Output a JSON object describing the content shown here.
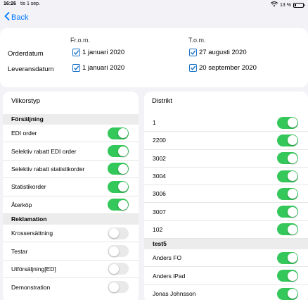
{
  "status_bar": {
    "time": "16:26",
    "date": "tis 1 sep.",
    "battery": "13 %",
    "battery_level": 0.13
  },
  "nav": {
    "back_label": "Back"
  },
  "dates": {
    "from_header": "Fr.o.m.",
    "to_header": "T.o.m.",
    "rows": [
      {
        "label": "Orderdatum",
        "from": "1 januari 2020",
        "to": "27 augusti 2020"
      },
      {
        "label": "Leveransdatum",
        "from": "1 januari 2020",
        "to": "20 september 2020"
      }
    ]
  },
  "vilkorstyp": {
    "title": "Vilkorstyp",
    "groups": [
      {
        "header": "Försäljning",
        "items": [
          {
            "label": "EDI order",
            "on": true
          },
          {
            "label": "Selektiv rabatt EDI order",
            "on": true
          },
          {
            "label": "Selektiv rabatt statistikorder",
            "on": true
          },
          {
            "label": "Statistikorder",
            "on": true
          },
          {
            "label": "Återköp",
            "on": true
          }
        ]
      },
      {
        "header": "Reklamation",
        "items": [
          {
            "label": "Krossersättning",
            "on": false
          },
          {
            "label": "Testar",
            "on": false
          },
          {
            "label": "Utförsäljning[ED]",
            "on": false
          },
          {
            "label": "Demonstration",
            "on": false
          }
        ]
      }
    ]
  },
  "distrikt": {
    "title": "Distrikt",
    "groups": [
      {
        "header": "",
        "items": [
          {
            "label": "1",
            "on": true
          },
          {
            "label": "2200",
            "on": true
          },
          {
            "label": "3002",
            "on": true
          },
          {
            "label": "3004",
            "on": true
          },
          {
            "label": "3006",
            "on": true
          },
          {
            "label": "3007",
            "on": true
          },
          {
            "label": "102",
            "on": true
          }
        ]
      },
      {
        "header": "test5",
        "items": [
          {
            "label": "Anders FO",
            "on": true
          },
          {
            "label": "Anders iPad",
            "on": true
          },
          {
            "label": "Jonas Johnsson",
            "on": true
          }
        ]
      }
    ]
  },
  "colors": {
    "accent": "#007aff",
    "toggle_on": "#34c759",
    "toggle_off": "#e9e9ea",
    "checkbox": "#1a73c7"
  }
}
